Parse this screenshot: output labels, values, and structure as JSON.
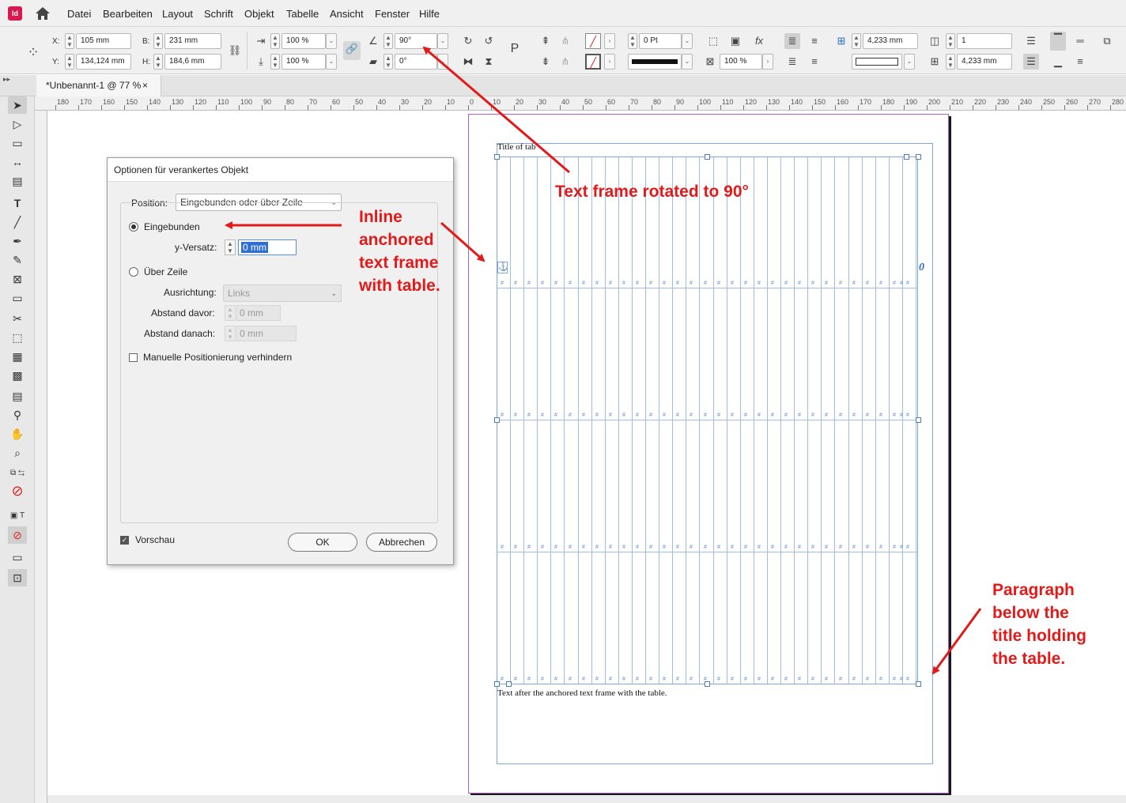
{
  "menu": {
    "logo": "Id",
    "items": [
      "Datei",
      "Bearbeiten",
      "Layout",
      "Schrift",
      "Objekt",
      "Tabelle",
      "Ansicht",
      "Fenster",
      "Hilfe"
    ]
  },
  "control": {
    "x_label": "X:",
    "x_value": "105 mm",
    "y_label": "Y:",
    "y_value": "134,124 mm",
    "w_label": "B:",
    "w_value": "231 mm",
    "h_label": "H:",
    "h_value": "184,6 mm",
    "scale_x": "100 %",
    "scale_y": "100 %",
    "rotation": "90°",
    "shear": "0°",
    "stroke_weight": "0 Pt",
    "opacity": "100 %",
    "gap_1": "4,233 mm",
    "gap_2": "4,233 mm",
    "columns": "1"
  },
  "tab": {
    "title": "*Unbenannt-1 @ 77 %",
    "close": "×"
  },
  "ruler": {
    "h_ticks": [
      "180",
      "170",
      "160",
      "150",
      "140",
      "130",
      "120",
      "110",
      "100",
      "90",
      "80",
      "70",
      "60",
      "50",
      "40",
      "30",
      "20",
      "10",
      "0",
      "10",
      "20",
      "30",
      "40",
      "50",
      "60",
      "70",
      "80",
      "90",
      "100",
      "110",
      "120",
      "130",
      "140",
      "150",
      "160",
      "170",
      "180",
      "190",
      "200",
      "210",
      "220",
      "230",
      "240",
      "250",
      "260",
      "270",
      "280"
    ]
  },
  "document": {
    "title_text": "Title of tab",
    "after_text": "Text after the anchored text frame with the table.",
    "overset_marker": "0"
  },
  "dialog": {
    "title": "Optionen für verankertes Objekt",
    "position_label": "Position:",
    "position_value": "Eingebunden oder über Zeile",
    "radio_inline": "Eingebunden",
    "y_offset_label": "y-Versatz:",
    "y_offset_value": "0 mm",
    "radio_above": "Über Zeile",
    "alignment_label": "Ausrichtung:",
    "alignment_value": "Links",
    "space_before_label": "Abstand davor:",
    "space_before_value": "0 mm",
    "space_after_label": "Abstand danach:",
    "space_after_value": "0 mm",
    "prevent_manual_label": "Manuelle Positionierung verhindern",
    "preview_label": "Vorschau",
    "ok_label": "OK",
    "cancel_label": "Abbrechen"
  },
  "annotations": {
    "rotated": "Text frame rotated to 90°",
    "inline_lines": [
      "Inline",
      "anchored",
      "text frame",
      "with table."
    ],
    "paragraph_lines": [
      "Paragraph",
      "below the",
      "title holding",
      "the table."
    ]
  },
  "colors": {
    "annotation": "#e21a1a",
    "frame_blue": "#7ea7d6",
    "page_border": "#b15ccf",
    "app_logo": "#d6194e"
  }
}
